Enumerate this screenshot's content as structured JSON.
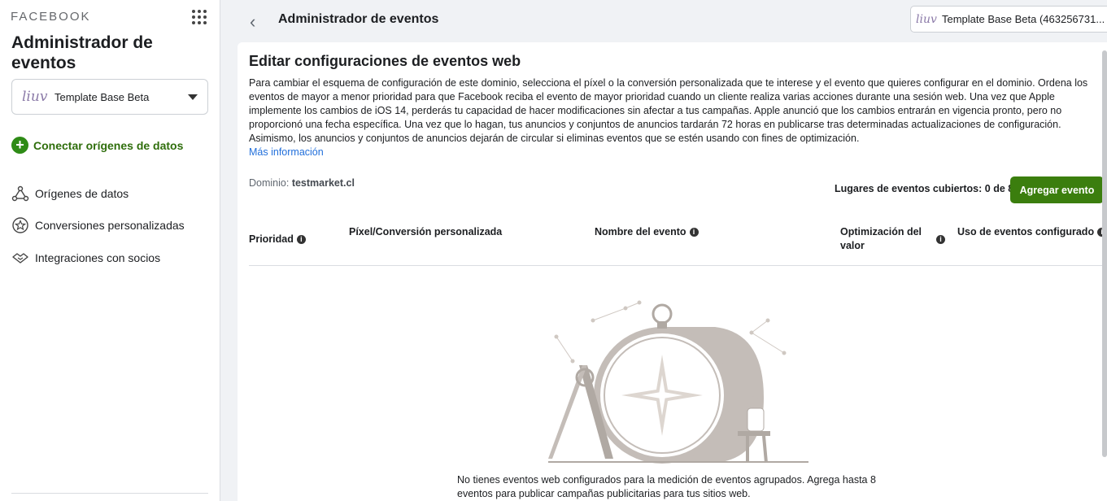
{
  "sidebar": {
    "brand": "FACEBOOK",
    "title": "Administrador de eventos",
    "account": {
      "logo": "liuv",
      "name": "Template Base Beta"
    },
    "connect_label": "Conectar orígenes de datos",
    "items": [
      {
        "label": "Orígenes de datos",
        "icon": "data-sources-icon"
      },
      {
        "label": "Conversiones personalizadas",
        "icon": "star-badge-icon"
      },
      {
        "label": "Integraciones con socios",
        "icon": "handshake-icon"
      }
    ]
  },
  "header": {
    "title": "Administrador de eventos",
    "account_label": "Template Base Beta (463256731..."
  },
  "main": {
    "title": "Editar configuraciones de eventos web",
    "description": "Para cambiar el esquema de configuración de este dominio, selecciona el píxel o la conversión personalizada que te interese y el evento que quieres configurar en el dominio. Ordena los eventos de mayor a menor prioridad para que Facebook reciba el evento de mayor prioridad cuando un cliente realiza varias acciones durante una sesión web. Una vez que Apple implemente los cambios de iOS 14, perderás tu capacidad de hacer modificaciones sin afectar a tus campañas. Apple anunció que los cambios entrarán en vigencia pronto, pero no proporcionó una fecha específica. Una vez que lo hagan, tus anuncios y conjuntos de anuncios tardarán 72 horas en publicarse tras determinadas actualizaciones de configuración. Asimismo, los anuncios y conjuntos de anuncios dejarán de circular si eliminas eventos que se estén usando con fines de optimización.",
    "more_info": "Más información",
    "domain_label": "Dominio:",
    "domain_value": "testmarket.cl",
    "covered": "Lugares de eventos cubiertos: 0 de 8",
    "add_button": "Agregar evento",
    "columns": [
      "Prioridad",
      "Píxel/Conversión personalizada",
      "Nombre del evento",
      "Optimización del valor",
      "Uso de eventos configurado"
    ],
    "empty_message": "No tienes eventos web configurados para la medición de eventos agrupados. Agrega hasta 8 eventos para publicar campañas publicitarias para tus sitios web."
  },
  "colors": {
    "accent_green": "#3b7e0e",
    "link_blue": "#216fdb",
    "illustration_gray": "#cfc8c2"
  }
}
